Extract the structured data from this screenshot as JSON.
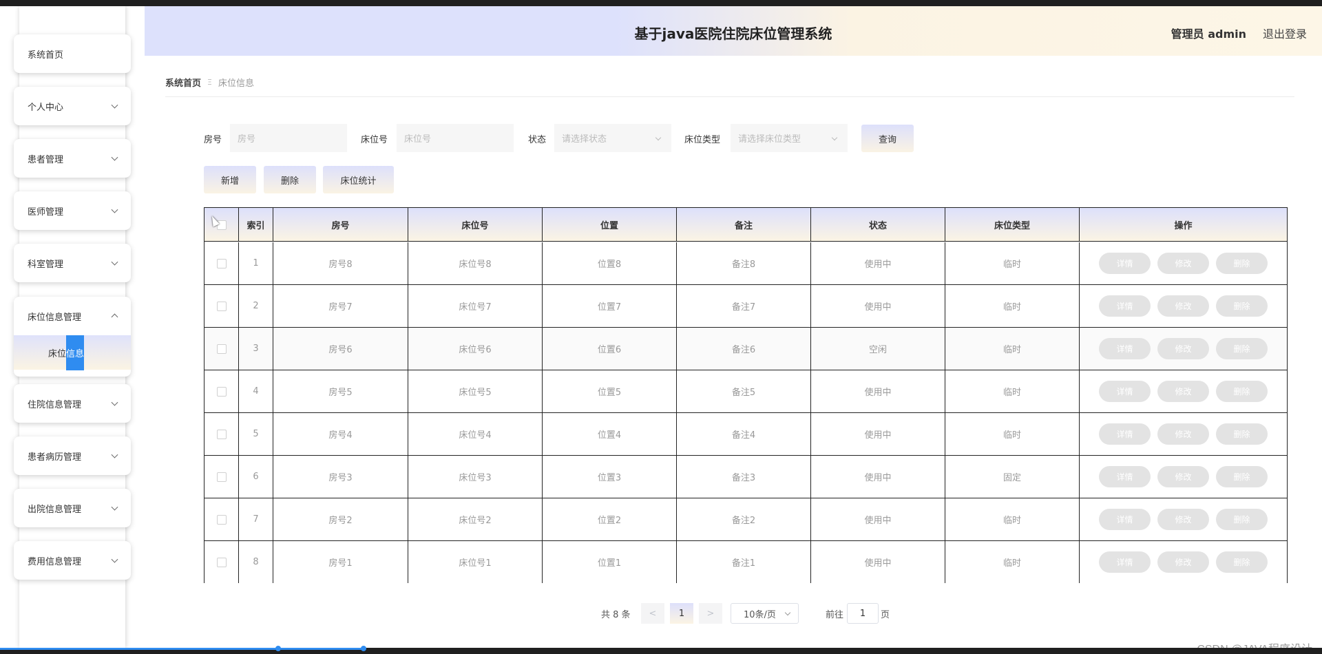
{
  "header": {
    "title": "基于java医院住院床位管理系统",
    "user": "管理员 admin",
    "logout": "退出登录"
  },
  "sidebar": {
    "items": [
      {
        "label": "系统首页"
      },
      {
        "label": "个人中心"
      },
      {
        "label": "患者管理"
      },
      {
        "label": "医师管理"
      },
      {
        "label": "科室管理"
      },
      {
        "label": "床位信息管理"
      },
      {
        "label": "住院信息管理"
      },
      {
        "label": "患者病历管理"
      },
      {
        "label": "出院信息管理"
      },
      {
        "label": "费用信息管理"
      }
    ],
    "submenu": {
      "part1": "床位",
      "part2": "信息"
    }
  },
  "breadcrumb": {
    "home": "系统首页",
    "separator": "Ξ",
    "current": "床位信息"
  },
  "search": {
    "room_label": "房号",
    "room_placeholder": "房号",
    "bed_label": "床位号",
    "bed_placeholder": "床位号",
    "status_label": "状态",
    "status_placeholder": "请选择状态",
    "type_label": "床位类型",
    "type_placeholder": "请选择床位类型",
    "query_button": "查询"
  },
  "toolbar": {
    "add": "新增",
    "delete": "删除",
    "stats": "床位统计"
  },
  "table": {
    "headers": {
      "index": "索引",
      "room": "房号",
      "bed": "床位号",
      "location": "位置",
      "remark": "备注",
      "status": "状态",
      "type": "床位类型",
      "actions": "操作"
    },
    "action_labels": {
      "detail": "详情",
      "edit": "修改",
      "delete": "删除"
    },
    "rows": [
      {
        "index": "1",
        "room": "房号8",
        "bed": "床位号8",
        "location": "位置8",
        "remark": "备注8",
        "status": "使用中",
        "type": "临时"
      },
      {
        "index": "2",
        "room": "房号7",
        "bed": "床位号7",
        "location": "位置7",
        "remark": "备注7",
        "status": "使用中",
        "type": "临时"
      },
      {
        "index": "3",
        "room": "房号6",
        "bed": "床位号6",
        "location": "位置6",
        "remark": "备注6",
        "status": "空闲",
        "type": "临时"
      },
      {
        "index": "4",
        "room": "房号5",
        "bed": "床位号5",
        "location": "位置5",
        "remark": "备注5",
        "status": "使用中",
        "type": "临时"
      },
      {
        "index": "5",
        "room": "房号4",
        "bed": "床位号4",
        "location": "位置4",
        "remark": "备注4",
        "status": "使用中",
        "type": "临时"
      },
      {
        "index": "6",
        "room": "房号3",
        "bed": "床位号3",
        "location": "位置3",
        "remark": "备注3",
        "status": "使用中",
        "type": "固定"
      },
      {
        "index": "7",
        "room": "房号2",
        "bed": "床位号2",
        "location": "位置2",
        "remark": "备注2",
        "status": "使用中",
        "type": "临时"
      },
      {
        "index": "8",
        "room": "房号1",
        "bed": "床位号1",
        "location": "位置1",
        "remark": "备注1",
        "status": "使用中",
        "type": "临时"
      }
    ]
  },
  "pagination": {
    "total": "共 8 条",
    "prev": "<",
    "current": "1",
    "next": ">",
    "page_size": "10条/页",
    "goto_prefix": "前往",
    "goto_value": "1",
    "goto_suffix": "页"
  },
  "watermark": "CSDN @JAVA程序设计",
  "colors": {
    "accent_blue": "#2f8cf0",
    "gradient_start": "#dde0fb",
    "gradient_end": "#fbf4e4"
  }
}
